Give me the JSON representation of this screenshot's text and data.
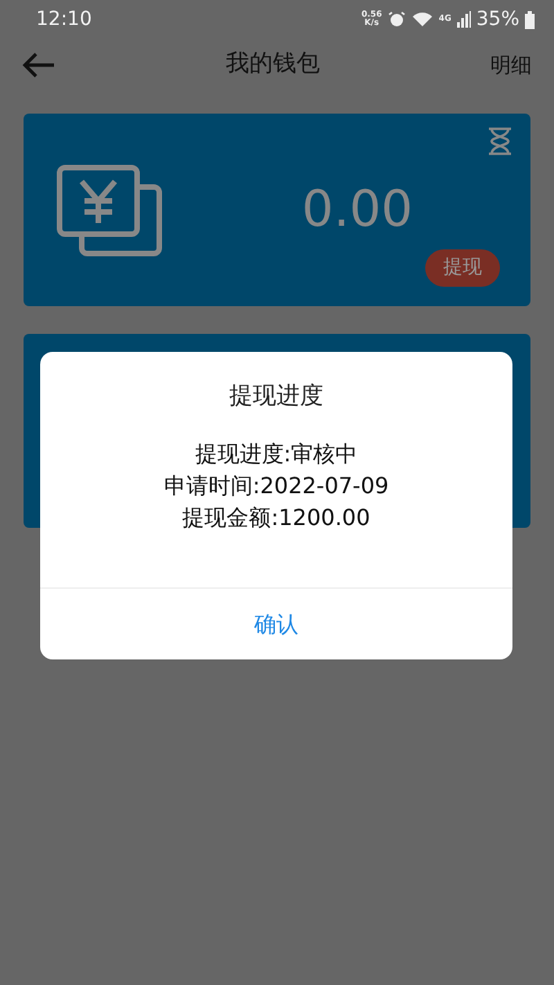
{
  "status_bar": {
    "time": "12:10",
    "net_speed": [
      "0.56",
      "K/s"
    ],
    "network": "4G",
    "battery": "35%"
  },
  "header": {
    "title": "我的钱包",
    "action": "明细"
  },
  "wallet_card": {
    "balance": "0.00",
    "withdraw_button": "提现"
  },
  "dialog": {
    "title": "提现进度",
    "lines": [
      "提现进度:审核中",
      "申请时间:2022-07-09",
      "提现金额:1200.00"
    ],
    "confirm": "确认"
  }
}
